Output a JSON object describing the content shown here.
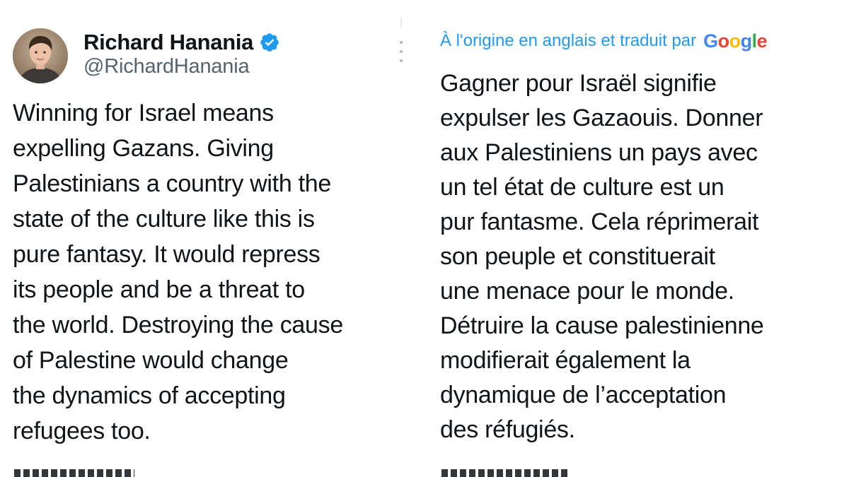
{
  "tweet": {
    "author_name": "Richard Hanania",
    "author_handle": "@RichardHanania",
    "verified": true,
    "text": "Winning for Israel means\nexpelling Gazans. Giving\nPalestinians a country with the\nstate of the culture like this is\npure fantasy. It would repress\nits people and be a threat to\nthe world. Destroying the cause\nof Palestine would change\nthe dynamics of accepting\nrefugees too."
  },
  "translation": {
    "label": "À l'origine en anglais et traduit par",
    "provider": {
      "letters": [
        "G",
        "o",
        "o",
        "g",
        "l",
        "e"
      ],
      "colors": [
        "#4285f4",
        "#ea4335",
        "#fbbc05",
        "#4285f4",
        "#34a853",
        "#ea4335"
      ]
    },
    "text": "Gagner pour Israël signifie\nexpulser les Gazaouis. Donner\naux Palestiniens un pays avec\nun tel état de culture est un\npur fantasme. Cela réprimerait\nson peuple et constituerait\nune menace pour le monde.\nDétruire la cause palestinienne\nmodifierait également la\ndynamique de l’acceptation\ndes réfugiés."
  },
  "icons": {
    "verified": "verified-badge-icon",
    "more": "more-options-icon"
  },
  "colors": {
    "text_primary": "#0f1419",
    "text_secondary": "#536471",
    "accent_blue": "#1d9bf0"
  }
}
